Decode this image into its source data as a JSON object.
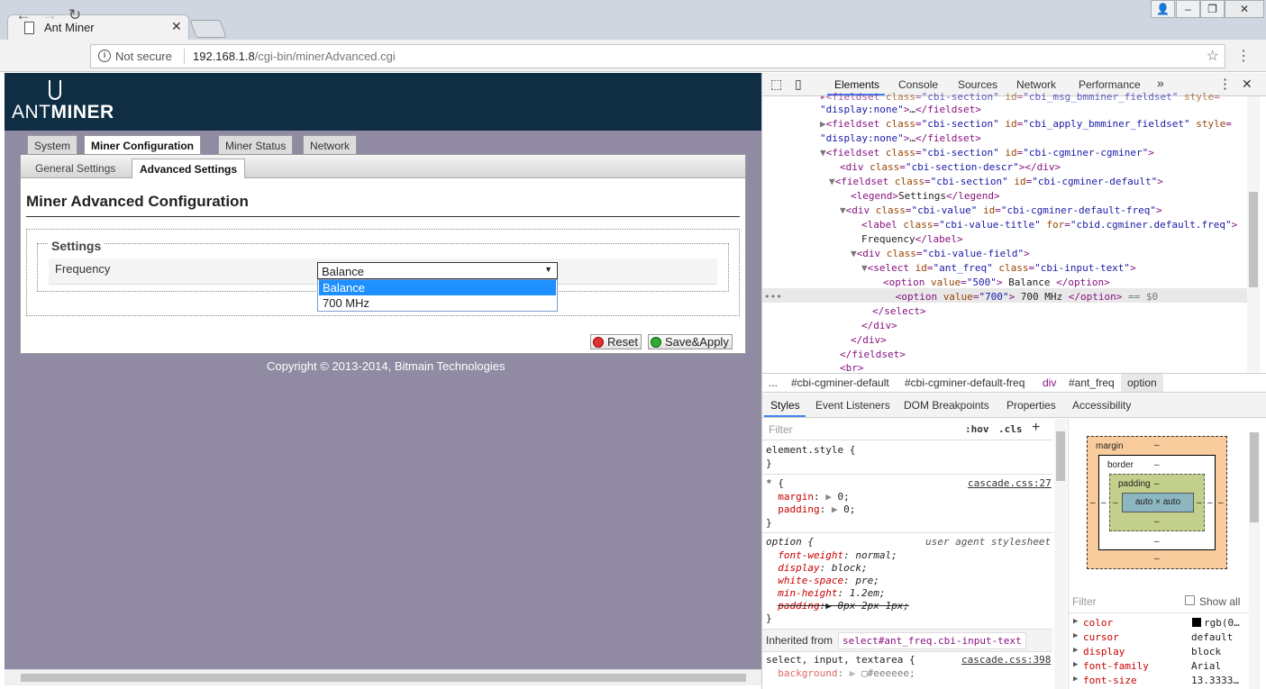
{
  "browser": {
    "tab_title": "Ant Miner",
    "security_label": "Not secure",
    "url_host": "192.168.1.8",
    "url_path": "/cgi-bin/minerAdvanced.cgi"
  },
  "page": {
    "logo_prefix": "ANT",
    "logo_suffix": "MINER",
    "tabs": [
      "System",
      "Miner Configuration",
      "Miner Status",
      "Network"
    ],
    "active_tab": "Miner Configuration",
    "subtabs": [
      "General Settings",
      "Advanced Settings"
    ],
    "active_subtab": "Advanced Settings",
    "title": "Miner Advanced Configuration",
    "legend": "Settings",
    "frequency_label": "Frequency",
    "frequency_value": "Balance",
    "frequency_options": [
      "Balance",
      "700 MHz"
    ],
    "reset_label": "Reset",
    "save_label": "Save&Apply",
    "copyright": "Copyright © 2013-2014, Bitmain Technologies"
  },
  "devtools": {
    "tabs": [
      "Elements",
      "Console",
      "Sources",
      "Network",
      "Performance"
    ],
    "more": "»",
    "breadcrumbs": [
      "...",
      "#cbi-cgminer-default",
      "#cbi-cgminer-default-freq",
      "div",
      "#ant_freq",
      "option"
    ],
    "styles_tabs": [
      "Styles",
      "Event Listeners",
      "DOM Breakpoints",
      "Properties",
      "Accessibility"
    ],
    "filter_placeholder": "Filter",
    "hov": ":hov",
    "cls": ".cls",
    "inherited_from": "Inherited from",
    "inherited_selector": "select#ant_freq.cbi-input-text",
    "computed_filter": "Filter",
    "show_all": "Show all",
    "box": {
      "margin": "margin",
      "border": "border",
      "padding": "padding",
      "content": "auto × auto",
      "dash": "–"
    },
    "computed": [
      {
        "prop": "color",
        "val": "rgb(0…"
      },
      {
        "prop": "cursor",
        "val": "default"
      },
      {
        "prop": "display",
        "val": "block"
      },
      {
        "prop": "font-family",
        "val": "Arial"
      },
      {
        "prop": "font-size",
        "val": "13.3333…"
      }
    ],
    "css": {
      "element_style": "element.style {",
      "star_rule": "* {",
      "star_src": "cascade.css:27",
      "option_rule": "option {",
      "option_src": "user agent stylesheet",
      "select_rule": "select, input, textarea {",
      "select_src": "cascade.css:398"
    }
  }
}
